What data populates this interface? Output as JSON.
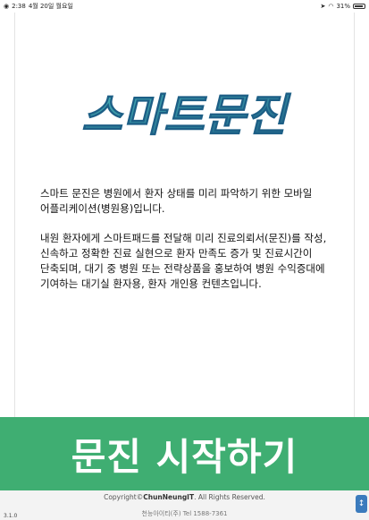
{
  "status_bar": {
    "time": "2:38",
    "date": "4월 20일 월요일",
    "battery": "31%"
  },
  "logo": {
    "text": "스마트문진",
    "colors": {
      "primary": "#1d5f86",
      "accent": "#49b3b8"
    }
  },
  "intro": {
    "paragraph_1": " 스마트 문진은 병원에서 환자 상태를 미리 파악하기 위한 모바일 어플리케이션(병원용)입니다.",
    "paragraph_2": " 내원 환자에게 스마트패드를 전달해 미리 진료의뢰서(문진)를 작성, 신속하고 정확한 진료 실현으로 환자 만족도 증가 및 진료시간이 단축되며, 대기 중 병원 또는 전략상품을 홍보하여 병원 수익증대에 기여하는 대기실 환자용, 환자 개인용 컨텐츠입니다."
  },
  "start_button": {
    "label": "문진 시작하기",
    "color": "#3fae72"
  },
  "footer": {
    "copyright_prefix": "Copyright",
    "copyright_symbol": "©",
    "company_name": "ChunNeungIT",
    "copyright_suffix": ". All Rights Reserved.",
    "company_line": "천능아이티(주) Tel 1588-7361"
  },
  "version": "3.1.0",
  "icons": {
    "wifi": "wifi-icon",
    "battery": "battery-icon",
    "app_corner": "app-icon"
  }
}
